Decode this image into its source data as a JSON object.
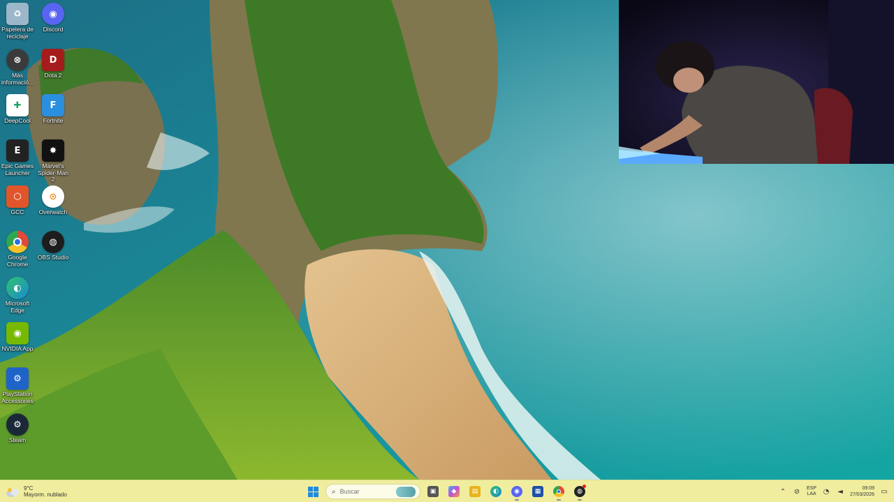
{
  "desktop_icons": [
    {
      "label": "Papelera de reciclaje",
      "icon": "recycle-bin-icon",
      "glyph": "♻",
      "color": "#9bb7c9"
    },
    {
      "label": "Discord",
      "icon": "discord-icon",
      "glyph": "◉",
      "color": "#5865f2"
    },
    {
      "label": "Más informació...",
      "icon": "info-icon",
      "glyph": "⊗",
      "color": "#3b3b3b"
    },
    {
      "label": "Dota 2",
      "icon": "dota2-icon",
      "glyph": "D",
      "color": "#a61c1c"
    },
    {
      "label": "DeepCool",
      "icon": "deepcool-icon",
      "glyph": "✚",
      "color": "#1fa463"
    },
    {
      "label": "Fortnite",
      "icon": "fortnite-icon",
      "glyph": "F",
      "color": "#2b8fe0"
    },
    {
      "label": "Epic Games Launcher",
      "icon": "epic-games-icon",
      "glyph": "E",
      "color": "#222222"
    },
    {
      "label": "Marvel's Spider-Man 2",
      "icon": "spiderman-icon",
      "glyph": "✸",
      "color": "#111111"
    },
    {
      "label": "GCC",
      "icon": "gcc-icon",
      "glyph": "⬡",
      "color": "#e2552a"
    },
    {
      "label": "Overwatch",
      "icon": "overwatch-icon",
      "glyph": "⊙",
      "color": "#f08c1e"
    },
    {
      "label": "Google Chrome",
      "icon": "chrome-icon",
      "glyph": "◎",
      "color": "#e04a3a"
    },
    {
      "label": "OBS Studio",
      "icon": "obs-icon",
      "glyph": "◍",
      "color": "#1d1d1d"
    },
    {
      "label": "Microsoft Edge",
      "icon": "edge-icon",
      "glyph": "◐",
      "color": "#1b8ad1"
    },
    {
      "label": "NVIDIA App",
      "icon": "nvidia-icon",
      "glyph": "◉",
      "color": "#76b900"
    },
    {
      "label": "PlayStation Accessories",
      "icon": "playstation-icon",
      "glyph": "⚙",
      "color": "#1f63c9"
    },
    {
      "label": "Steam",
      "icon": "steam-icon",
      "glyph": "⚙",
      "color": "#1b2838"
    }
  ],
  "taskbar": {
    "weather": {
      "temp": "9°C",
      "condition": "Mayorm. nublado"
    },
    "search": {
      "placeholder": "Buscar"
    },
    "apps": [
      {
        "name": "task-view",
        "glyph": "▣",
        "color": "#555555"
      },
      {
        "name": "copilot",
        "glyph": "◆",
        "color": "#c34fd6"
      },
      {
        "name": "file-explorer",
        "glyph": "▤",
        "color": "#e8b31e"
      },
      {
        "name": "edge",
        "glyph": "◐",
        "color": "#1b8ad1"
      },
      {
        "name": "discord",
        "glyph": "◉",
        "color": "#5865f2"
      },
      {
        "name": "store",
        "glyph": "▦",
        "color": "#1f4fa8"
      },
      {
        "name": "chrome",
        "glyph": "◎",
        "color": "#e04a3a"
      },
      {
        "name": "game",
        "glyph": "✦",
        "color": "#222222"
      }
    ],
    "tray": {
      "lang_top": "ESP",
      "lang_bottom": "LAA",
      "time": "09:09",
      "date": "27/03/2026"
    }
  }
}
